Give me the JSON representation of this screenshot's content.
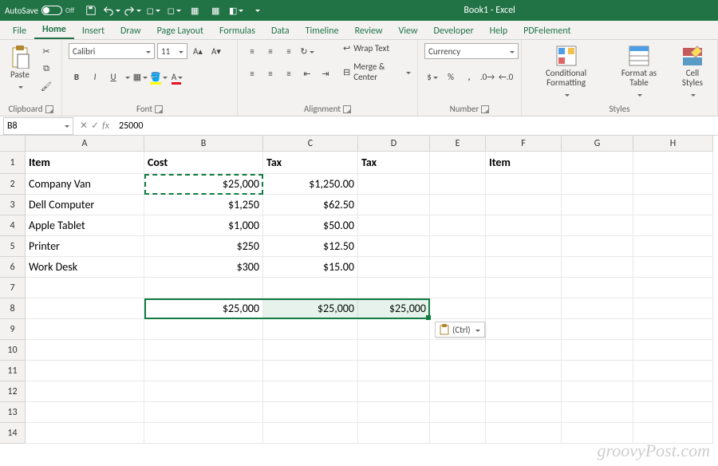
{
  "titlebar": {
    "autosave_label": "AutoSave",
    "autosave_state": "Off",
    "apptitle": "Book1 - Excel"
  },
  "tabs": [
    "File",
    "Home",
    "Insert",
    "Draw",
    "Page Layout",
    "Formulas",
    "Data",
    "Timeline",
    "Review",
    "View",
    "Developer",
    "Help",
    "PDFelement"
  ],
  "active_tab": "Home",
  "ribbon": {
    "clipboard": {
      "paste": "Paste",
      "label": "Clipboard"
    },
    "font": {
      "name": "Calibri",
      "size": "11",
      "bold": "B",
      "italic": "I",
      "underline": "U",
      "label": "Font"
    },
    "alignment": {
      "wrap": "Wrap Text",
      "merge": "Merge & Center",
      "label": "Alignment"
    },
    "number": {
      "format": "Currency",
      "label": "Number"
    },
    "styles": {
      "cond": "Conditional Formatting",
      "table": "Format as Table",
      "cell": "Cell Styles",
      "label": "Styles"
    }
  },
  "fx": {
    "namebox": "B8",
    "formula": "25000",
    "fx_label": "fx"
  },
  "columns": [
    "A",
    "B",
    "C",
    "D",
    "E",
    "F",
    "G",
    "H"
  ],
  "rows": [
    {
      "n": "1",
      "h": "h1",
      "A": "Item",
      "B": "Cost",
      "C": "Tax",
      "D": "Tax",
      "E": "",
      "F": "Item",
      "G": "",
      "H": "",
      "bold": true
    },
    {
      "n": "2",
      "h": "hN",
      "A": "Company Van",
      "B": "$25,000",
      "C": "$1,250.00",
      "D": "",
      "E": "",
      "F": "",
      "G": "",
      "H": ""
    },
    {
      "n": "3",
      "h": "hN",
      "A": "Dell Computer",
      "B": "$1,250",
      "C": "$62.50",
      "D": "",
      "E": "",
      "F": "",
      "G": "",
      "H": ""
    },
    {
      "n": "4",
      "h": "hN",
      "A": "Apple Tablet",
      "B": "$1,000",
      "C": "$50.00",
      "D": "",
      "E": "",
      "F": "",
      "G": "",
      "H": ""
    },
    {
      "n": "5",
      "h": "hN",
      "A": "Printer",
      "B": "$250",
      "C": "$12.50",
      "D": "",
      "E": "",
      "F": "",
      "G": "",
      "H": ""
    },
    {
      "n": "6",
      "h": "hN",
      "A": "Work Desk",
      "B": "$300",
      "C": "$15.00",
      "D": "",
      "E": "",
      "F": "",
      "G": "",
      "H": ""
    },
    {
      "n": "7",
      "h": "hN",
      "A": "",
      "B": "",
      "C": "",
      "D": "",
      "E": "",
      "F": "",
      "G": "",
      "H": ""
    },
    {
      "n": "8",
      "h": "hN",
      "A": "",
      "B": "$25,000",
      "C": "$25,000",
      "D": "$25,000",
      "E": "",
      "F": "",
      "G": "",
      "H": ""
    },
    {
      "n": "9",
      "h": "hN",
      "A": "",
      "B": "",
      "C": "",
      "D": "",
      "E": "",
      "F": "",
      "G": "",
      "H": ""
    },
    {
      "n": "10",
      "h": "hN",
      "A": "",
      "B": "",
      "C": "",
      "D": "",
      "E": "",
      "F": "",
      "G": "",
      "H": ""
    },
    {
      "n": "11",
      "h": "hN",
      "A": "",
      "B": "",
      "C": "",
      "D": "",
      "E": "",
      "F": "",
      "G": "",
      "H": ""
    },
    {
      "n": "12",
      "h": "hN",
      "A": "",
      "B": "",
      "C": "",
      "D": "",
      "E": "",
      "F": "",
      "G": "",
      "H": ""
    },
    {
      "n": "13",
      "h": "hN",
      "A": "",
      "B": "",
      "C": "",
      "D": "",
      "E": "",
      "F": "",
      "G": "",
      "H": ""
    },
    {
      "n": "14",
      "h": "hN",
      "A": "",
      "B": "",
      "C": "",
      "D": "",
      "E": "",
      "F": "",
      "G": "",
      "H": ""
    }
  ],
  "smarttag": {
    "label": "(Ctrl)"
  },
  "watermark": "groovyPost.com"
}
